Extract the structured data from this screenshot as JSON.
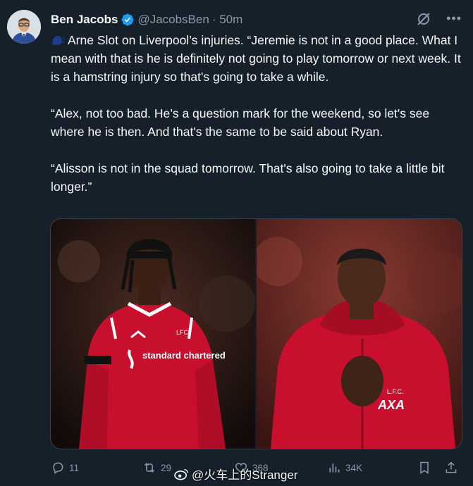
{
  "author": {
    "name": "Ben Jacobs",
    "handle": "@JacobsBen",
    "time": "· 50m",
    "avatar_icon": "person-avatar",
    "verified_icon": "verified-badge-icon",
    "verified_color": "#1d9bf0"
  },
  "tweet": {
    "paragraphs": [
      "Arne Slot on Liverpool’s injuries. “Jeremie is not in a good place. What I mean with that is he is definitely not going to play tomorrow or next week. It is a hamstring injury so that's going to take a while.",
      "“Alex, not too bad. He’s a question mark for the weekend, so let's see where he is then. And that's the same to be said about Ryan.",
      "“Alisson is not in the squad tomorrow. That's also going to take a little bit longer.”"
    ],
    "lead_icon": "speaking-head-icon"
  },
  "media": {
    "left_photo": {
      "sponsor_text": "standard chartered",
      "crest_text": "LFC"
    },
    "right_photo": {
      "crest_text": "L.F.C.",
      "sponsor_text": "AXA"
    }
  },
  "actions": {
    "replies": "11",
    "reposts": "29",
    "likes": "368",
    "views": "34K"
  },
  "watermark": {
    "text": "@火车上的Stranger"
  },
  "colors": {
    "background": "#15202b",
    "text": "#f7f9f9",
    "muted": "#8b98a5",
    "accent": "#1d9bf0",
    "kit_red": "#c8102e"
  }
}
